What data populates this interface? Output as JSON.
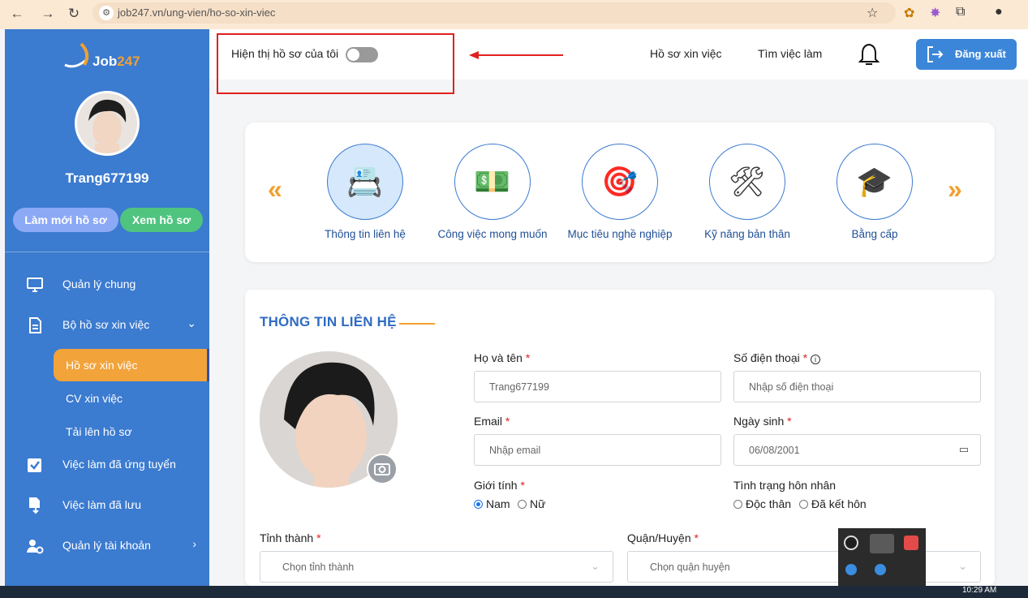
{
  "browser": {
    "url": "job247.vn/ung-vien/ho-so-xin-viec"
  },
  "sidebar": {
    "logo_text": "Job",
    "logo_text_accent": "247",
    "username": "Trang677199",
    "refresh_button": "Làm mới hồ sơ",
    "view_button": "Xem hồ sơ",
    "nav": [
      {
        "label": "Quản lý chung",
        "icon": "monitor-icon"
      },
      {
        "label": "Bộ hồ sơ xin việc",
        "icon": "document-icon"
      },
      {
        "label": "Việc làm đã ứng tuyển",
        "icon": "checkbox-icon"
      },
      {
        "label": "Việc làm đã lưu",
        "icon": "file-download-icon"
      },
      {
        "label": "Quản lý tài khoản",
        "icon": "user-settings-icon"
      }
    ],
    "subnav": [
      {
        "label": "Hồ sơ xin việc",
        "active": true
      },
      {
        "label": "CV xin việc"
      },
      {
        "label": "Tải lên hồ sơ"
      }
    ]
  },
  "header": {
    "show_profile_label": "Hiện thị hồ sơ của tôi",
    "show_profile_enabled": false,
    "nav_resume": "Hồ sơ xin việc",
    "nav_jobs": "Tìm việc làm",
    "logout": "Đăng xuất"
  },
  "steps": {
    "prev": "«",
    "next": "»",
    "items": [
      {
        "label": "Thông tin liên hệ",
        "icon": "contact-icon",
        "active": true
      },
      {
        "label": "Công việc mong muốn",
        "icon": "money-icon"
      },
      {
        "label": "Mục tiêu nghề nghiệp",
        "icon": "target-icon"
      },
      {
        "label": "Kỹ năng bản thân",
        "icon": "tools-icon"
      },
      {
        "label": "Bằng cấp",
        "icon": "graduation-cap-icon"
      }
    ]
  },
  "form": {
    "title": "THÔNG TIN LIÊN HỆ",
    "fullname_label": "Họ và tên",
    "fullname_value": "Trang677199",
    "phone_label": "Số điện thoại",
    "phone_placeholder": "Nhập số điện thoại",
    "email_label": "Email",
    "email_placeholder": "Nhập email",
    "dob_label": "Ngày sinh",
    "dob_value": "06/08/2001",
    "gender_label": "Giới tính",
    "gender_male": "Nam",
    "gender_female": "Nữ",
    "gender_selected": "Nam",
    "marital_label": "Tình trạng hôn nhân",
    "marital_single": "Độc thân",
    "marital_married": "Đã kết hôn",
    "province_label": "Tỉnh thành",
    "province_placeholder": "Chọn tỉnh thành",
    "district_label": "Quận/Huyện",
    "district_placeholder": "Chọn quận huyện",
    "required_mark": "*"
  },
  "taskbar": {
    "time": "10:29 AM"
  },
  "colors": {
    "sidebar": "#3b7bd0",
    "accent": "#f0a030",
    "active_sub": "#f2a33a",
    "view_button": "#4fc47f",
    "refresh_button": "#8ba9f5",
    "logout_button": "#3b86d8",
    "highlight_box": "#e02020"
  }
}
